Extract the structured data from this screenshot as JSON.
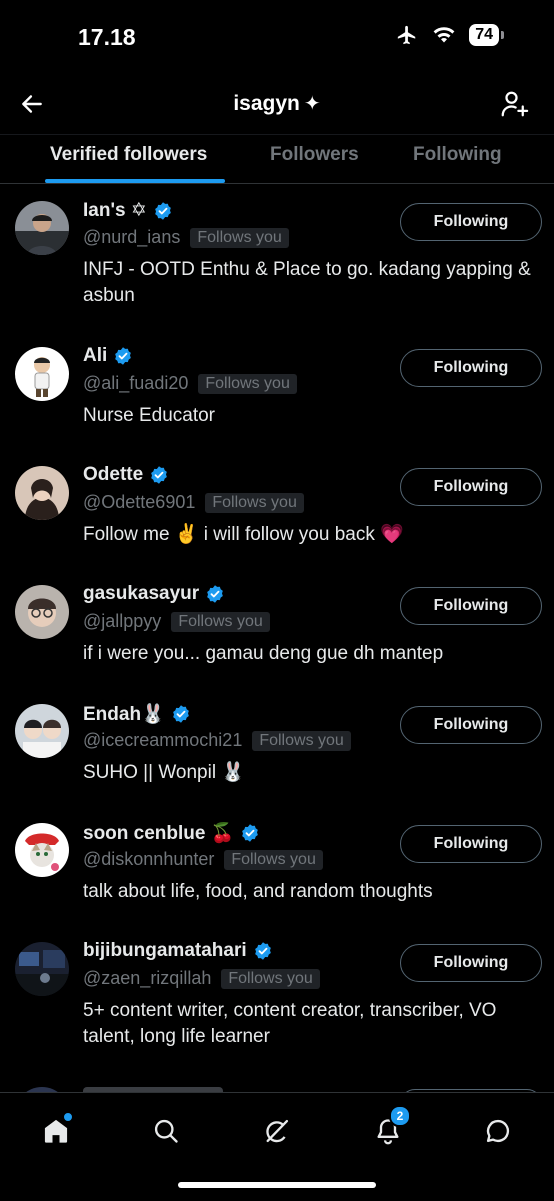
{
  "status_bar": {
    "time": "17.18",
    "battery": "74"
  },
  "header": {
    "title": "isagyn",
    "title_icon": "sparkle-icon"
  },
  "tabs": [
    {
      "label": "Verified followers",
      "active": true
    },
    {
      "label": "Followers",
      "active": false
    },
    {
      "label": "Following",
      "active": false
    }
  ],
  "users": [
    {
      "name": "Ian's ✡",
      "handle": "@nurd_ians",
      "badge": "Follows you",
      "bio": "INFJ - OOTD Enthu & Place to go. kadang yapping & asbun",
      "button": "Following"
    },
    {
      "name": "Ali",
      "handle": "@ali_fuadi20",
      "badge": "Follows you",
      "bio": "Nurse Educator",
      "button": "Following"
    },
    {
      "name": "Odette",
      "handle": "@Odette6901",
      "badge": "Follows you",
      "bio": "Follow me ✌️ i will follow you back 💗",
      "button": "Following"
    },
    {
      "name": "gasukasayur",
      "handle": "@jallppyy",
      "badge": "Follows you",
      "bio": "if i were you... gamau deng gue dh mantep",
      "button": "Following"
    },
    {
      "name": "Endah🐰",
      "handle": "@icecreammochi21",
      "badge": "Follows you",
      "bio": "SUHO || Wonpil 🐰",
      "button": "Following"
    },
    {
      "name": "soon cenblue 🍒",
      "handle": "@diskonnhunter",
      "badge": "Follows you",
      "bio": "talk about life, food, and random thoughts",
      "button": "Following"
    },
    {
      "name": "bijibungamatahari",
      "handle": "@zaen_rizqillah",
      "badge": "Follows you",
      "bio": "5+ content writer, content creator, transcriber, VO talent, long life learner",
      "button": "Following"
    }
  ],
  "bottom_nav": [
    {
      "icon": "home-icon",
      "dot": true
    },
    {
      "icon": "search-icon"
    },
    {
      "icon": "grok-icon"
    },
    {
      "icon": "bell-icon",
      "badge": "2"
    },
    {
      "icon": "messages-icon"
    }
  ],
  "colors": {
    "accent": "#1d9bf0",
    "background": "#000000",
    "secondary_text": "#71767b",
    "border": "#2f3336"
  }
}
